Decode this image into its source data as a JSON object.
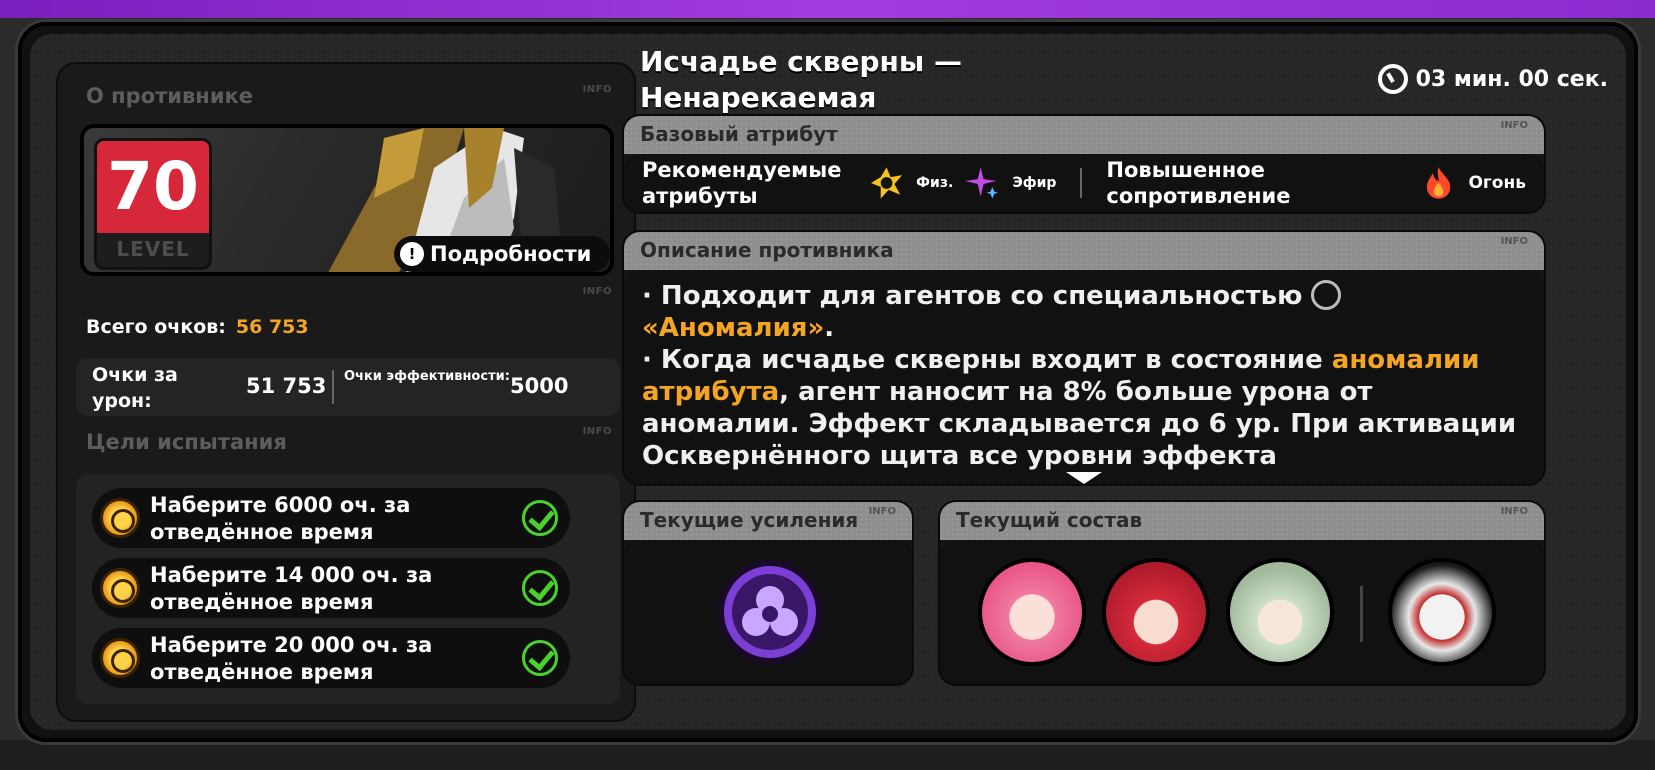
{
  "colors": {
    "accent": "#f5a524",
    "level": "#d6283a",
    "check": "#4bd12e",
    "top": "#a33be0"
  },
  "info_label": "INFO",
  "enemy": {
    "section_title": "О противнике",
    "level_number": "70",
    "level_label": "LEVEL",
    "details_label": "Подробности",
    "total_label": "Всего очков:",
    "total_value": "56 753",
    "damage_label": "Очки за урон:",
    "damage_value": "51 753",
    "efficiency_label": "Очки эффективности:",
    "efficiency_value": "5000"
  },
  "goals": {
    "section_title": "Цели испытания",
    "items": [
      {
        "text": "Наберите 6000 оч. за отведённое время",
        "done": true
      },
      {
        "text": "Наберите 14 000 оч. за отведённое время",
        "done": true
      },
      {
        "text": "Наберите 20 000 оч. за отведённое время",
        "done": true
      }
    ]
  },
  "boss": {
    "title": "Исчадье скверны — Ненарекаемая",
    "timer": "03 мин. 00 сек."
  },
  "attribute": {
    "header": "Базовый атрибут",
    "recommended_label": "Рекомендуемые атрибуты",
    "rec1": "Физ.",
    "rec2": "Эфир",
    "resist_label": "Повышенное сопротивление",
    "resist1": "Огонь"
  },
  "description": {
    "header": "Описание противника",
    "p1_a": "· Подходит для агентов со специальностью",
    "p1_b": "«Аномалия»",
    "p1_c": ".",
    "p2_a": "· Когда исчадье скверны входит в состояние",
    "p2_b": "аномалии атрибута",
    "p2_c": ", агент наносит на 8% больше урона от аномалии. Эффект складывается до 6 ур. При активации Осквернённого щита все уровни эффекта"
  },
  "buffs": {
    "header": "Текущие усиления"
  },
  "team": {
    "header": "Текущий состав"
  }
}
